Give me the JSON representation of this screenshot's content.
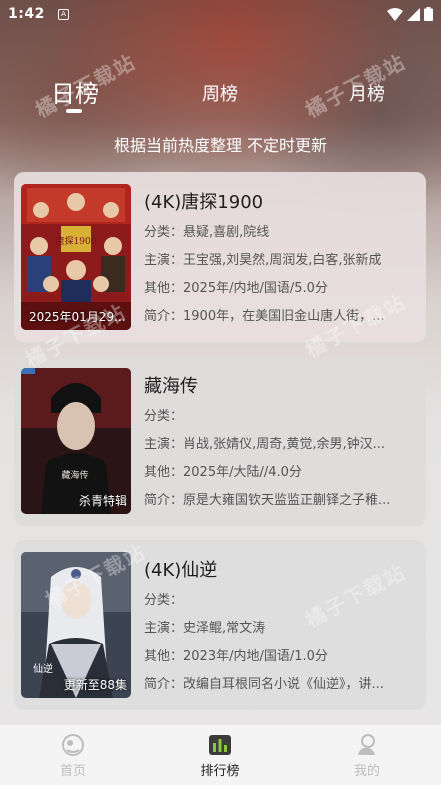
{
  "status_bar": {
    "time": "1:42",
    "badge": "A"
  },
  "tabs": [
    {
      "label": "日榜",
      "active": true
    },
    {
      "label": "周榜",
      "active": false
    },
    {
      "label": "月榜",
      "active": false
    }
  ],
  "subtitle": "根据当前热度整理 不定时更新",
  "watermark": "橘子下载站",
  "items": [
    {
      "title": "(4K)唐探1900",
      "category": "分类：悬疑,喜剧,院线",
      "cast": "主演：王宝强,刘昊然,周润发,白客,张新成",
      "other": "其他：2025年/内地/国语/5.0分",
      "summary": "简介：1900年，在美国旧金山唐人街，...",
      "poster_caption": "2025年01月29...",
      "poster_title": "唐探1900"
    },
    {
      "title": "藏海传",
      "category": "分类：",
      "cast": "主演：肖战,张婧仪,周奇,黄觉,余男,钟汉...",
      "other": "其他：2025年/大陆//4.0分",
      "summary": "简介：原是大雍国钦天监监正蒯铎之子稚...",
      "poster_caption": "杀青特辑",
      "poster_title": "藏海传"
    },
    {
      "title": "(4K)仙逆",
      "category": "分类：",
      "cast": "主演：史泽鲲,常文涛",
      "other": "其他：2023年/内地/国语/1.0分",
      "summary": "简介：改编自耳根同名小说《仙逆》，讲...",
      "poster_caption": "更新至88集",
      "poster_title": "仙逆"
    }
  ],
  "nav": [
    {
      "label": "首页",
      "icon": "home-icon",
      "active": false
    },
    {
      "label": "排行榜",
      "icon": "ranking-icon",
      "active": true
    },
    {
      "label": "我的",
      "icon": "profile-icon",
      "active": false
    }
  ],
  "colors": {
    "active_nav_icon": "#8cc63f",
    "text_dark": "#1f1f1f",
    "text_muted": "#555555"
  }
}
